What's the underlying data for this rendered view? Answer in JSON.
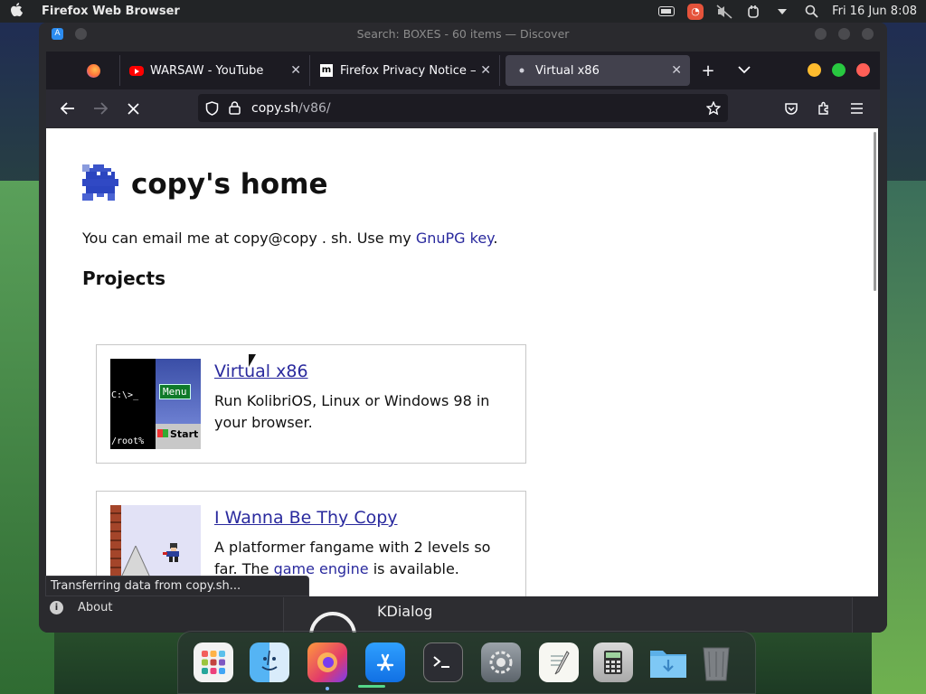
{
  "menubar": {
    "app_name": "Firefox Web Browser",
    "datetime": "Fri 16 Jun 8:08"
  },
  "window": {
    "title": "Search: BOXES - 60 items — Discover"
  },
  "tabs": [
    {
      "label": "WARSAW - YouTube",
      "icon": "youtube-icon"
    },
    {
      "label": "Firefox Privacy Notice —",
      "icon": "mozilla-icon"
    },
    {
      "label": "Virtual x86",
      "icon": "loading-dot-icon",
      "active": true
    }
  ],
  "urlbar": {
    "host": "copy.sh",
    "path": "/v86/"
  },
  "page": {
    "title": "copy's home",
    "email_prefix": "You can email me at copy@copy . sh. Use my ",
    "gpg_link": "GnuPG key",
    "email_suffix": ".",
    "projects_heading": "Projects",
    "cards": [
      {
        "title": "Virtual x86",
        "desc": "Run KolibriOS, Linux or Windows 98 in your browser.",
        "thumb_prompt": "C:\\>_",
        "thumb_root": "/root%",
        "thumb_menu": "Menu",
        "thumb_start": "Start"
      },
      {
        "title": "I Wanna Be Thy Copy",
        "desc_prefix": "A platformer fangame with 2 levels so far. The ",
        "desc_link": "game engine",
        "desc_suffix": " is available."
      }
    ]
  },
  "status": {
    "text": "Transferring data from copy.sh..."
  },
  "bottom": {
    "about": "About",
    "kdialog": "KDialog"
  },
  "dock": {
    "apps": [
      "launchpad-icon",
      "finder-icon",
      "firefox-icon",
      "app-store-icon",
      "terminal-icon",
      "system-settings-icon",
      "text-editor-icon",
      "calculator-icon",
      "downloads-folder-icon",
      "trash-icon"
    ]
  },
  "colors": {
    "link": "#2a2a9e",
    "tab_active": "#42414d",
    "accent_red": "#ff5f57",
    "accent_yellow": "#febc2e",
    "accent_green": "#28c840"
  }
}
